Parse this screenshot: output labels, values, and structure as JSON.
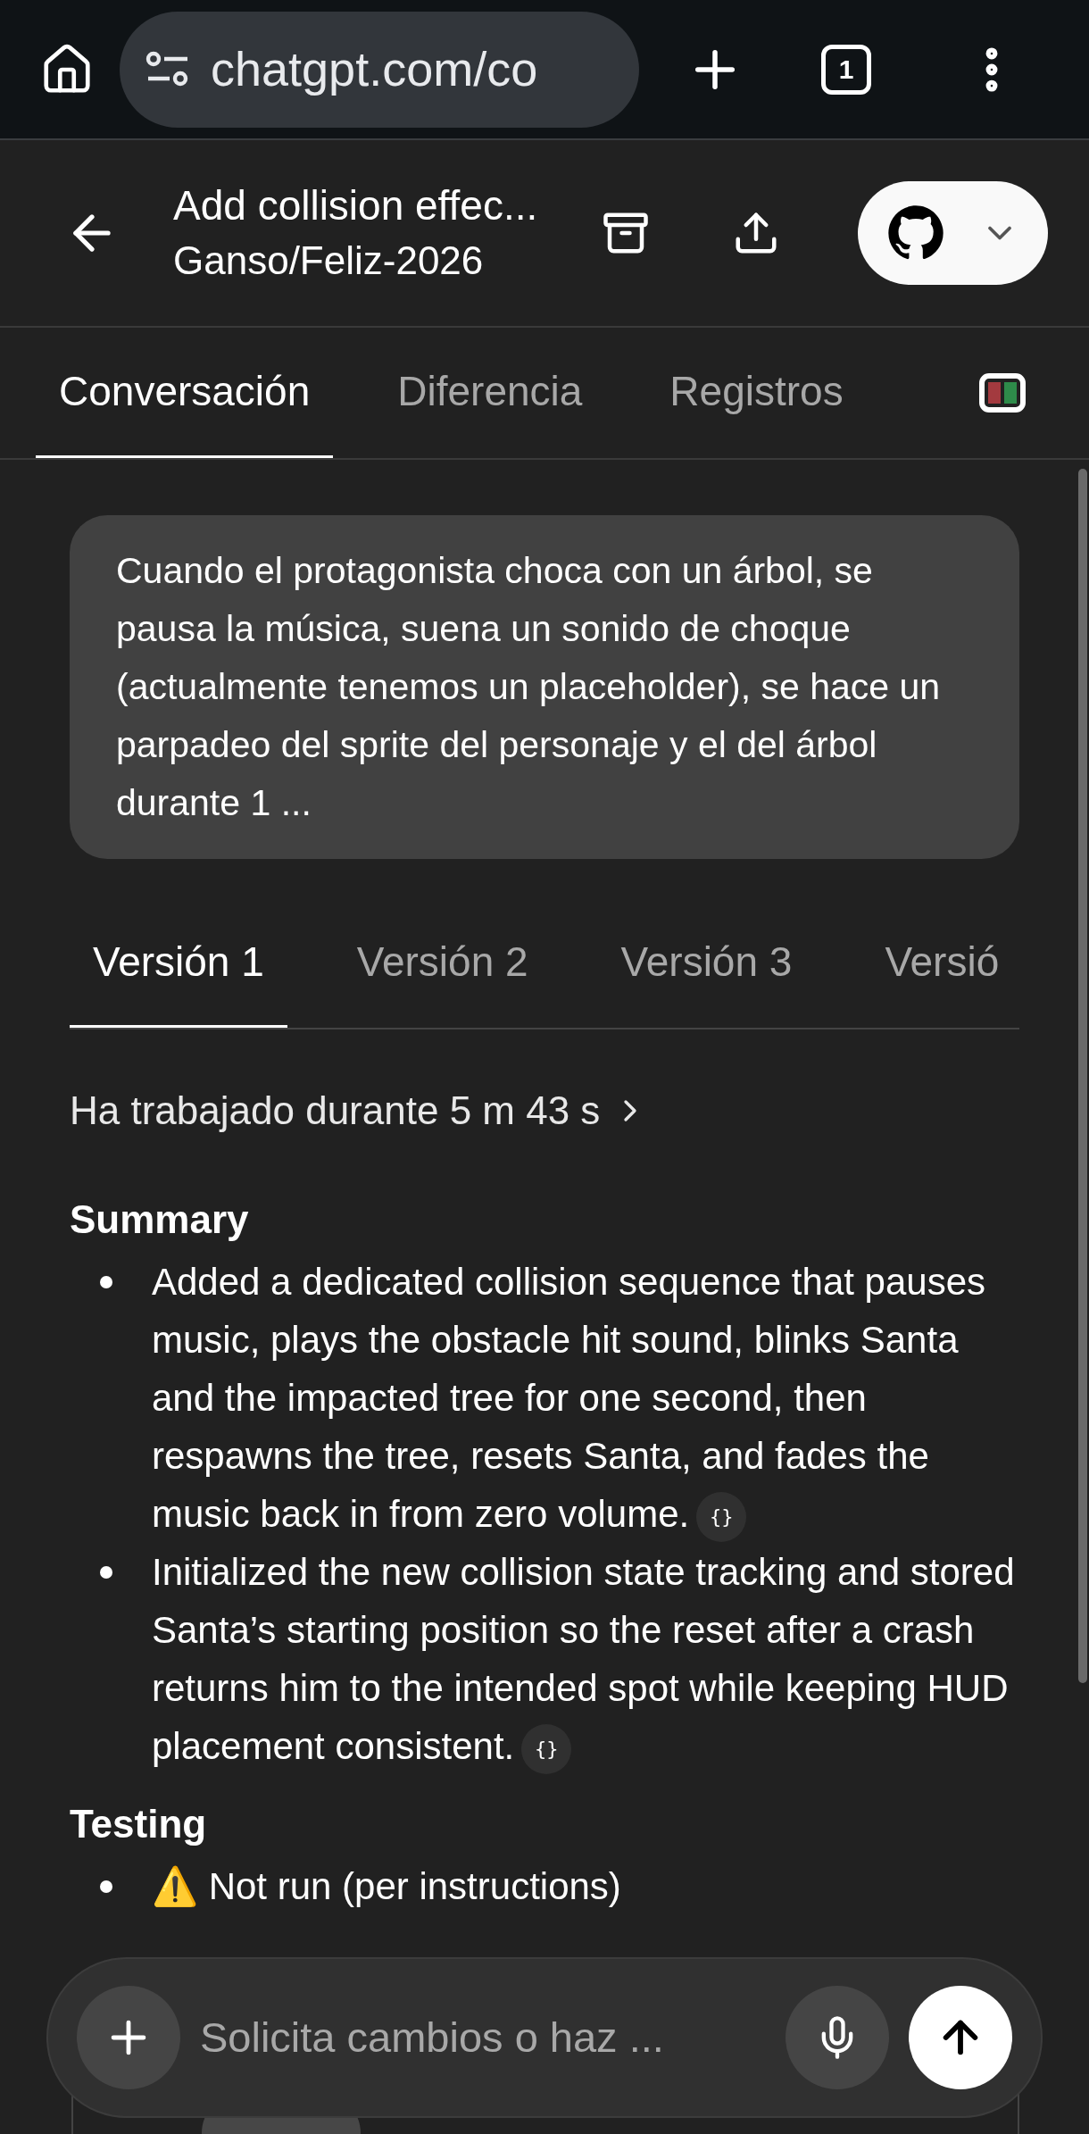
{
  "browser": {
    "url": "chatgpt.com/co",
    "tab_count": "1"
  },
  "header": {
    "title": "Add collision effec...",
    "subtitle": "Ganso/Feliz-2026"
  },
  "tabs": [
    {
      "label": "Conversación",
      "selected": true
    },
    {
      "label": "Diferencia",
      "selected": false
    },
    {
      "label": "Registros",
      "selected": false
    }
  ],
  "user_message": "Cuando el protagonista choca con un árbol, se pausa la música, suena un sonido de choque (actualmente tenemos un placeholder), se hace un parpadeo del sprite del personaje y el del árbol durante 1 ...",
  "version_tabs": [
    {
      "label": "Versión 1",
      "selected": true
    },
    {
      "label": "Versión 2",
      "selected": false
    },
    {
      "label": "Versión 3",
      "selected": false
    },
    {
      "label": "Versió",
      "selected": false
    }
  ],
  "worked": "Ha trabajado durante 5 m 43 s",
  "sections": [
    {
      "heading": "Summary",
      "items": [
        {
          "text": "Added a dedicated collision sequence that pauses music, plays the obstacle hit sound, blinks Santa and the impacted tree for one second, then respawns the tree, resets Santa, and fades the music back in from zero volume.",
          "citation": "{}"
        },
        {
          "text": "Initialized the new collision state tracking and stored Santa’s starting position so the reset after a crash returns him to the intended spot while keeping HUD placement consistent.",
          "citation": "{}"
        }
      ]
    },
    {
      "heading": "Testing",
      "items": [
        {
          "text": "⚠️ Not run (per instructions)"
        }
      ]
    }
  ],
  "composer": {
    "placeholder": "Solicita cambios o haz ..."
  }
}
